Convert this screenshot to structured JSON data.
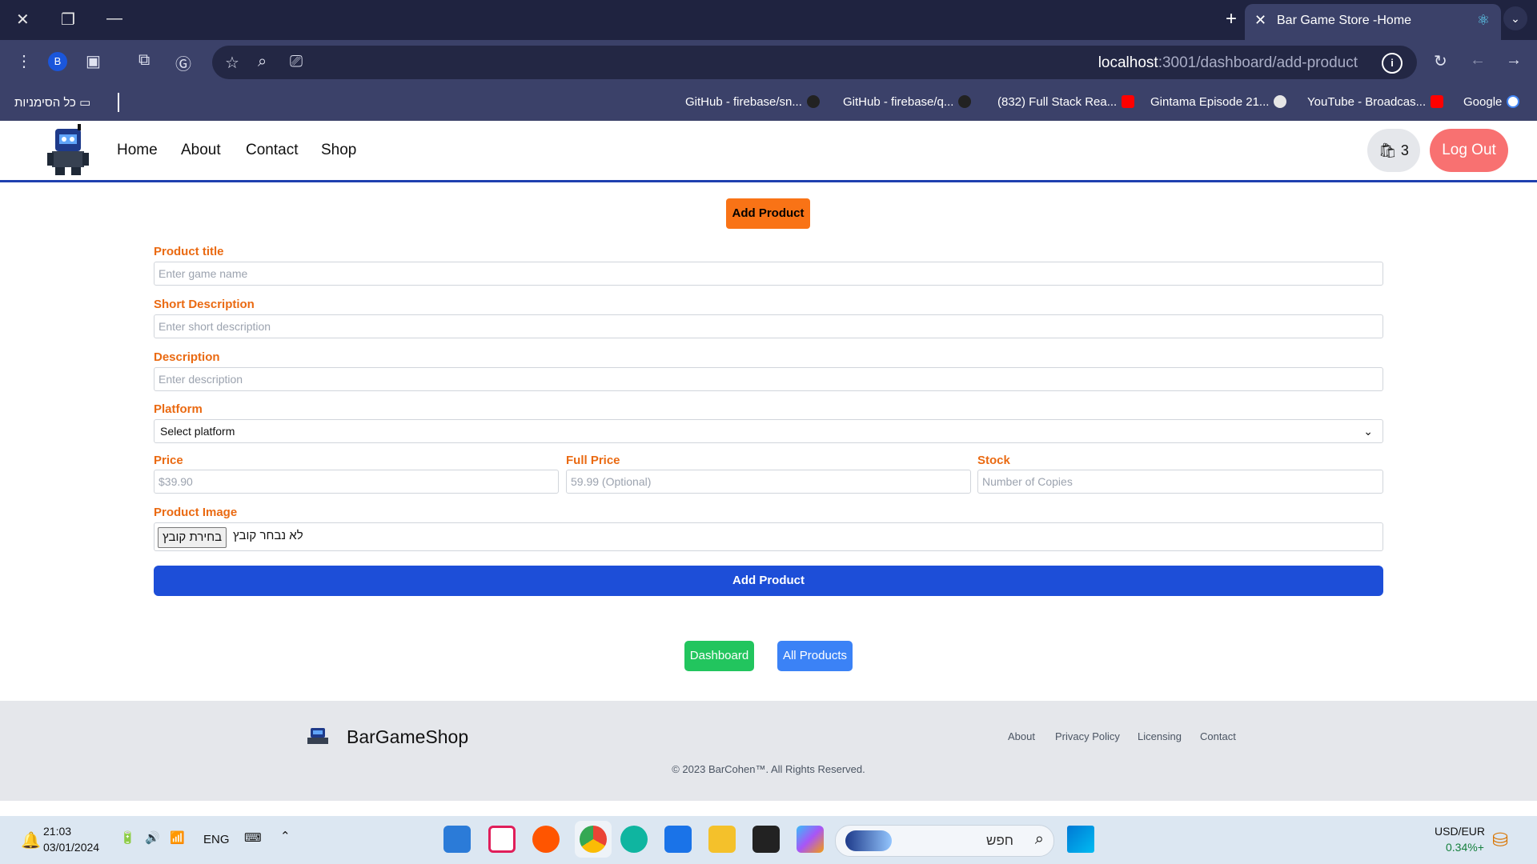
{
  "browser": {
    "tab_title": "Bar Game Store -Home",
    "profile_initial": "B",
    "url_host": "localhost",
    "url_path": ":3001/dashboard/add-product",
    "bookmarks": [
      {
        "label": "GitHub - firebase/sn...",
        "icon": "github-icon",
        "color": "#333"
      },
      {
        "label": "GitHub - firebase/q...",
        "icon": "github-icon",
        "color": "#333"
      },
      {
        "label": "(832) Full Stack Rea...",
        "icon": "youtube-icon",
        "color": "#ff0000"
      },
      {
        "label": "Gintama Episode 21...",
        "icon": "globe-icon",
        "color": "#e6e6e6"
      },
      {
        "label": "YouTube - Broadcas...",
        "icon": "youtube-icon",
        "color": "#ff0000"
      },
      {
        "label": "Google",
        "icon": "google-icon",
        "color": "#4285f4"
      }
    ],
    "all_bookmarks": "כל הסימניות"
  },
  "site": {
    "nav": {
      "home": "Home",
      "about": "About",
      "contact": "Contact",
      "shop": "Shop"
    },
    "cart_count": "3",
    "logout": "Log Out"
  },
  "form": {
    "heading": "Add Product",
    "title_label": "Product title",
    "title_placeholder": "Enter game name",
    "short_label": "Short Description",
    "short_placeholder": "Enter short description",
    "desc_label": "Description",
    "desc_placeholder": "Enter description",
    "platform_label": "Platform",
    "platform_selected": "Select platform",
    "price_label": "Price",
    "price_placeholder": "$39.90",
    "full_price_label": "Full Price",
    "full_price_placeholder": "59.99 (Optional)",
    "stock_label": "Stock",
    "stock_placeholder": "Number of Copies",
    "image_label": "Product Image",
    "file_button": "בחירת קובץ",
    "file_status": "לא נבחר קובץ",
    "submit": "Add Product"
  },
  "actions": {
    "dashboard": "Dashboard",
    "all_products": "All Products"
  },
  "footer": {
    "brand": "BarGameShop",
    "links": [
      "About",
      "Privacy Policy",
      "Licensing",
      "Contact"
    ],
    "copyright": "© 2023 BarCohen™. All Rights Reserved."
  },
  "taskbar": {
    "time": "21:03",
    "date": "03/01/2024",
    "lang": "ENG",
    "search_placeholder": "חפש",
    "currency_pair": "USD/EUR",
    "currency_change": "0.34%+"
  },
  "colors": {
    "accent_orange": "#f97316",
    "primary_blue": "#1d4ed8",
    "nav_border": "#1e40af"
  }
}
